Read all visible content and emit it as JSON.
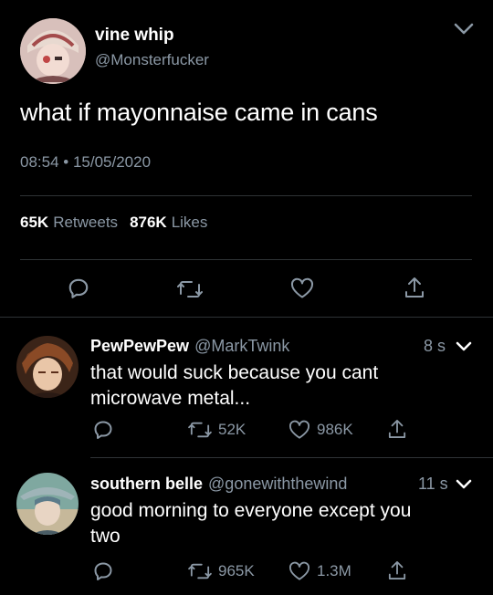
{
  "main_tweet": {
    "name": "vine whip",
    "handle": "@Monsterfucker",
    "text": "what if mayonnaise came in cans",
    "timestamp": "08:54 • 15/05/2020",
    "retweets_count": "65K",
    "retweets_label": "Retweets",
    "likes_count": "876K",
    "likes_label": "Likes"
  },
  "replies": [
    {
      "name": "PewPewPew",
      "handle": "@MarkTwink",
      "time": "8 s",
      "text_line1": "that would suck because you cant",
      "text_line2": "microwave metal...",
      "retweets": "52K",
      "likes": "986K"
    },
    {
      "name": "southern belle",
      "handle": "@gonewiththewind",
      "time": "11 s",
      "text_line1": "good morning to everyone except you",
      "text_line2": "two",
      "retweets": "965K",
      "likes": "1.3M"
    }
  ],
  "colors": {
    "background": "#000000",
    "muted": "#8b98a5",
    "divider": "#2f3336"
  },
  "icons": [
    "chevron-down-icon",
    "reply-icon",
    "retweet-icon",
    "like-icon",
    "share-icon"
  ]
}
